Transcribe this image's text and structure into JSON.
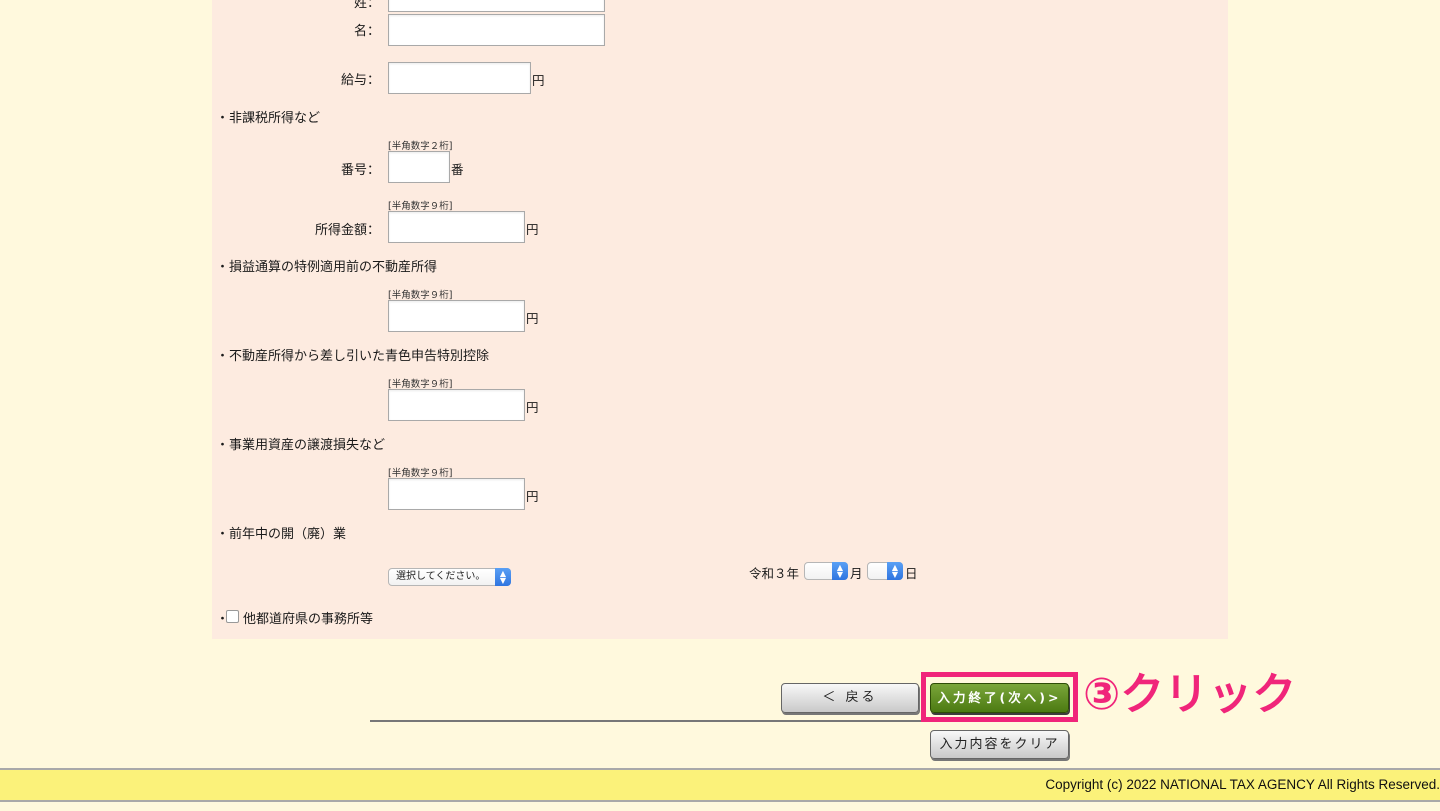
{
  "form": {
    "surname_label": "姓：",
    "name_label": "名：",
    "salary_label": "給与：",
    "yen": "円",
    "ban": "番",
    "section_nontax": "・非課税所得など",
    "note_2": "[半角数字２桁]",
    "note_9": "[半角数字９桁]",
    "number_label": "番号：",
    "income_amount_label": "所得金額：",
    "section_real_estate": "・損益通算の特例適用前の不動産所得",
    "section_blue": "・不動産所得から差し引いた青色申告特別控除",
    "section_business_asset": "・事業用資産の譲渡損失など",
    "section_open_close": "・前年中の開（廃）業",
    "select_placeholder": "選択してください。",
    "era_year": "令和３年",
    "month": "月",
    "day": "日",
    "other_pref_prefix": "・",
    "other_pref_label": "他都道府県の事務所等"
  },
  "buttons": {
    "back": "＜ 戻る",
    "finish": "入力終了(次へ)>",
    "clear": "入力内容をクリア"
  },
  "annotation": {
    "text": "③クリック",
    "color": "#f0257a"
  },
  "footer": {
    "copyright": "Copyright (c) 2022 NATIONAL TAX AGENCY All Rights Reserved."
  },
  "colors": {
    "page_bg": "#fff9dd",
    "panel_bg": "#fdebe0",
    "footer_bg": "#fbf27a",
    "primary_button": "#5a8a1e"
  }
}
